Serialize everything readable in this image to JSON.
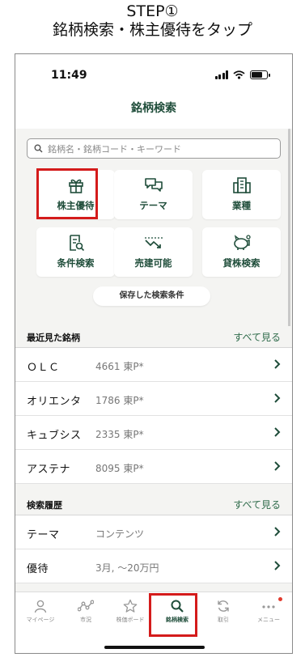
{
  "step": {
    "line1": "STEP①",
    "line2": "銘柄検索・株主優待をタップ"
  },
  "status": {
    "time": "11:49"
  },
  "nav": {
    "title": "銘柄検索"
  },
  "search": {
    "placeholder": "銘柄名・銘柄コード・キーワード",
    "icon": "search-icon"
  },
  "categories": [
    {
      "label": "株主優待",
      "icon": "gift-icon",
      "highlighted": true
    },
    {
      "label": "テーマ",
      "icon": "chat-bubbles-icon"
    },
    {
      "label": "業種",
      "icon": "building-icon"
    },
    {
      "label": "条件検索",
      "icon": "document-search-icon"
    },
    {
      "label": "売建可能",
      "icon": "trend-down-icon"
    },
    {
      "label": "貸株検索",
      "icon": "piggy-bank-icon"
    }
  ],
  "saved_conditions_label": "保存した検索条件",
  "recent": {
    "title": "最近見た銘柄",
    "see_all": "すべて見る",
    "items": [
      {
        "name": "ＯＬＣ",
        "detail": "4661 東P*"
      },
      {
        "name": "オリエンタ",
        "detail": "1786 東P*"
      },
      {
        "name": "キュブシス",
        "detail": "2335 東P*"
      },
      {
        "name": "アステナ",
        "detail": "8095 東P*"
      }
    ]
  },
  "history": {
    "title": "検索履歴",
    "see_all": "すべて見る",
    "items": [
      {
        "name": "テーマ",
        "detail": "コンテンツ"
      },
      {
        "name": "優待",
        "detail": "3月, ～20万円"
      }
    ]
  },
  "tabs": [
    {
      "label": "マイページ",
      "icon": "person-icon"
    },
    {
      "label": "市況",
      "icon": "market-chart-icon"
    },
    {
      "label": "株価ボード",
      "icon": "star-icon"
    },
    {
      "label": "銘柄検索",
      "icon": "search-icon",
      "active": true,
      "highlighted": true
    },
    {
      "label": "取引",
      "icon": "refresh-icon"
    },
    {
      "label": "メニュー",
      "icon": "more-dots-icon",
      "badge": true
    }
  ],
  "colors": {
    "accent": "#1f4d3a",
    "highlight": "#d41b1b",
    "link": "#2f6b4b",
    "badge": "#e23b2e"
  }
}
